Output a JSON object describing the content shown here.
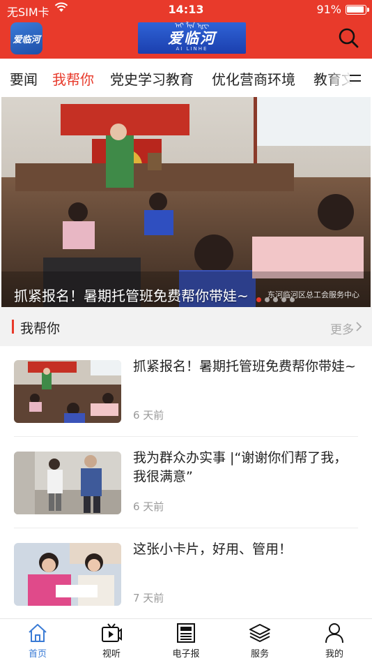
{
  "status_bar": {
    "carrier": "无SIM卡",
    "time": "14:13",
    "battery": "91%"
  },
  "header": {
    "app_icon_text": "爱临河",
    "logo_text": "爱临河",
    "logo_top_text": "ᠠᠢ ᠯᠢᠨ ᠾᠧ",
    "logo_sub_text": "AI LINHE",
    "accent_color": "#e83a2b"
  },
  "tabs": [
    {
      "label": "要闻"
    },
    {
      "label": "我帮你",
      "active": true
    },
    {
      "label": "党史学习教育"
    },
    {
      "label": "优化营商环境"
    },
    {
      "label": "教育文"
    }
  ],
  "banner": {
    "caption": "抓紧报名！暑期托管班免费帮你带娃~",
    "source": "东河临河区总工会服务中心",
    "slide_count": 5,
    "active_slide": 1
  },
  "section": {
    "title": "我帮你",
    "more": "更多"
  },
  "news": [
    {
      "title": "抓紧报名！暑期托管班免费帮你带娃~",
      "time": "6 天前"
    },
    {
      "title": "我为群众办实事 |“谢谢你们帮了我，我很满意”",
      "time": "6 天前"
    },
    {
      "title": "这张小卡片，好用、管用！",
      "time": "7 天前"
    }
  ],
  "bottom_nav": [
    {
      "label": "首页",
      "icon": "home-icon",
      "active": true
    },
    {
      "label": "视听",
      "icon": "tv-icon"
    },
    {
      "label": "电子报",
      "icon": "newspaper-icon"
    },
    {
      "label": "服务",
      "icon": "layers-icon"
    },
    {
      "label": "我的",
      "icon": "person-icon"
    }
  ]
}
